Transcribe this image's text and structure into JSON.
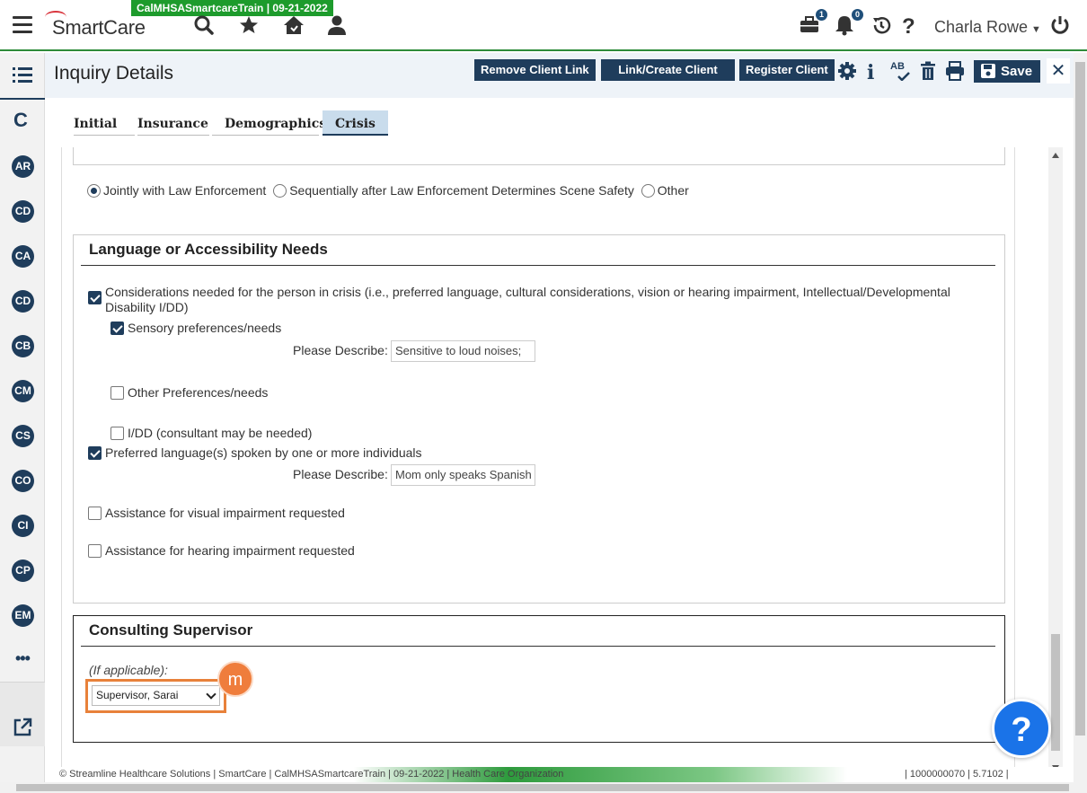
{
  "app": {
    "logo_text": "SmartCare",
    "environment_tag": "CalMHSASmartcareTrain | 09-21-2022",
    "user_name": "Charla Rowe",
    "briefcase_badge": "1",
    "bell_badge": "0"
  },
  "sidebar": {
    "c_label": "C",
    "clients": [
      "AR",
      "CD",
      "CA",
      "CD",
      "CB",
      "CM",
      "CS",
      "CO",
      "CI",
      "CP",
      "EM"
    ],
    "more_label": "•••"
  },
  "header": {
    "title": "Inquiry Details",
    "remove_client_link": "Remove Client Link",
    "link_create_client": "Link/Create Client",
    "register_client": "Register Client",
    "save_label": "Save",
    "spell_label": "AB"
  },
  "tabs": [
    {
      "label": "Initial"
    },
    {
      "label": "Insurance"
    },
    {
      "label": "Demographics"
    },
    {
      "label": "Crisis"
    }
  ],
  "response": {
    "options": [
      {
        "label": "Jointly with Law Enforcement",
        "selected": true
      },
      {
        "label": "Sequentially after Law Enforcement Determines Scene Safety",
        "selected": false
      },
      {
        "label": "Other",
        "selected": false
      }
    ]
  },
  "language_section": {
    "title": "Language or Accessibility Needs",
    "considerations": {
      "label": "Considerations needed for the person in crisis (i.e., preferred language, cultural considerations, vision or hearing impairment, Intellectual/Developmental Disability I/DD)",
      "checked": true
    },
    "sensory": {
      "label": "Sensory preferences/needs",
      "checked": true
    },
    "describe_label": "Please Describe:",
    "sensory_value": "Sensitive to loud noises;",
    "other_prefs": {
      "label": "Other Preferences/needs",
      "checked": false
    },
    "idd": {
      "label": "I/DD (consultant may be needed)",
      "checked": false
    },
    "preferred_language": {
      "label": "Preferred language(s) spoken by one or more individuals",
      "checked": true
    },
    "language_value": "Mom only speaks Spanish",
    "visual": {
      "label": "Assistance for visual impairment requested",
      "checked": false
    },
    "hearing": {
      "label": "Assistance for hearing impairment requested",
      "checked": false
    }
  },
  "supervisor_section": {
    "title": "Consulting Supervisor",
    "if_applicable": "(If applicable):",
    "selected": "Supervisor, Sarai",
    "marker": "m"
  },
  "footer": {
    "left": "© Streamline Healthcare Solutions | SmartCare | CalMHSASmartcareTrain | 09-21-2022 | Health Care Organization",
    "right": "| 1000000070 | 5.7102 |"
  },
  "help_label": "?",
  "colors": {
    "primary": "#1f3d5c",
    "env_green": "#1d9b2c",
    "highlight_orange": "#e8813a",
    "help_blue": "#1a73e8"
  }
}
